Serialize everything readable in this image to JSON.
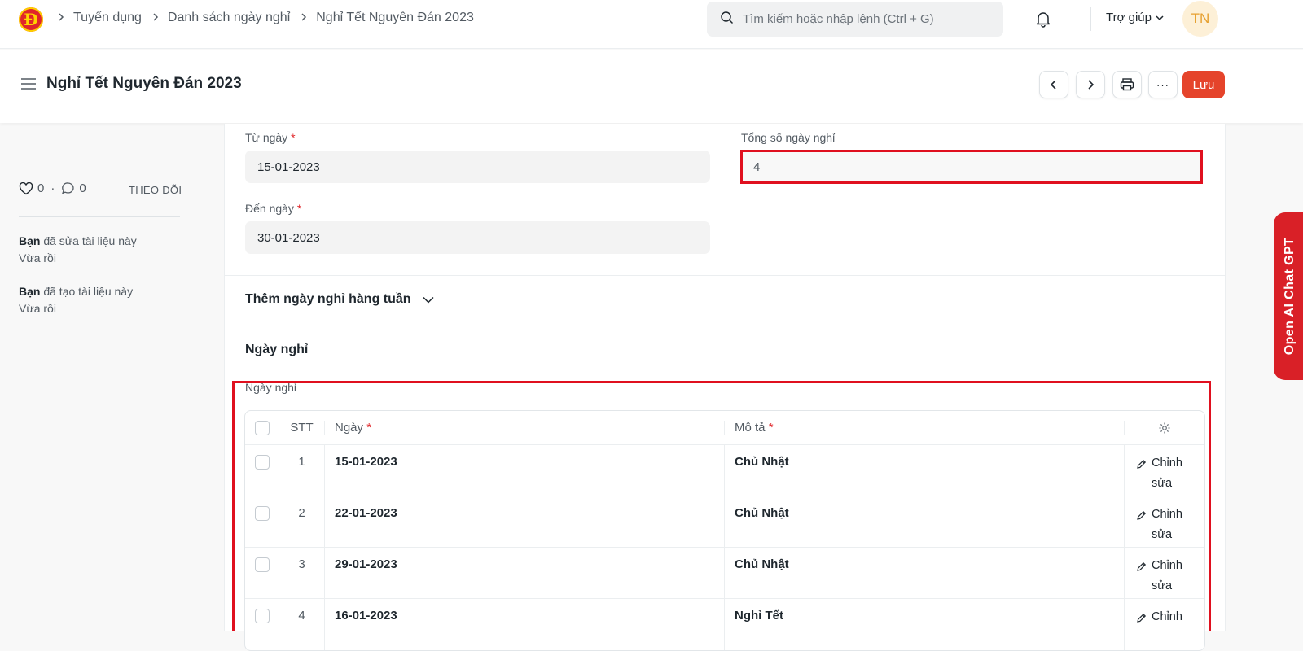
{
  "topbar": {
    "logo_letter": "Đ",
    "breadcrumbs": [
      "Tuyển dụng",
      "Danh sách ngày nghỉ",
      "Nghỉ Tết Nguyên Đán 2023"
    ],
    "search_placeholder": "Tìm kiếm hoặc nhập lệnh (Ctrl + G)",
    "help_label": "Trợ giúp",
    "avatar_initials": "TN"
  },
  "page": {
    "title": "Nghỉ Tết Nguyên Đán 2023",
    "save_label": "Lưu",
    "more_label": "···"
  },
  "sidebar": {
    "likes": "0",
    "comments": "0",
    "dot": "·",
    "follow_label": "THEO DÕI",
    "activity": [
      {
        "actor": "Bạn",
        "text": "đã sửa tài liệu này",
        "time": "Vừa rồi"
      },
      {
        "actor": "Bạn",
        "text": "đã tạo tài liệu này",
        "time": "Vừa rồi"
      }
    ]
  },
  "form": {
    "from_date_label": "Từ ngày",
    "from_date_value": "15-01-2023",
    "to_date_label": "Đến ngày",
    "to_date_value": "30-01-2023",
    "total_label": "Tổng số ngày nghỉ",
    "total_value": "4",
    "required_mark": "*",
    "weekly_section_label": "Thêm ngày nghỉ hàng tuần",
    "holidays_section_label": "Ngày nghỉ",
    "holidays_table_label": "Ngày nghỉ"
  },
  "table": {
    "columns": {
      "no": "STT",
      "date": "Ngày",
      "desc": "Mô tả"
    },
    "edit_line1": "Chỉnh",
    "edit_line2": "sửa",
    "rows": [
      {
        "no": "1",
        "date": "15-01-2023",
        "desc": "Chủ Nhật"
      },
      {
        "no": "2",
        "date": "22-01-2023",
        "desc": "Chủ Nhật"
      },
      {
        "no": "3",
        "date": "29-01-2023",
        "desc": "Chủ Nhật"
      },
      {
        "no": "4",
        "date": "16-01-2023",
        "desc": "Nghỉ Tết"
      }
    ]
  },
  "floating": {
    "gpt_label": "Open AI Chat GPT"
  },
  "colors": {
    "primary": "#e5442b",
    "highlight": "#e0101f",
    "gpt": "#d92027"
  }
}
